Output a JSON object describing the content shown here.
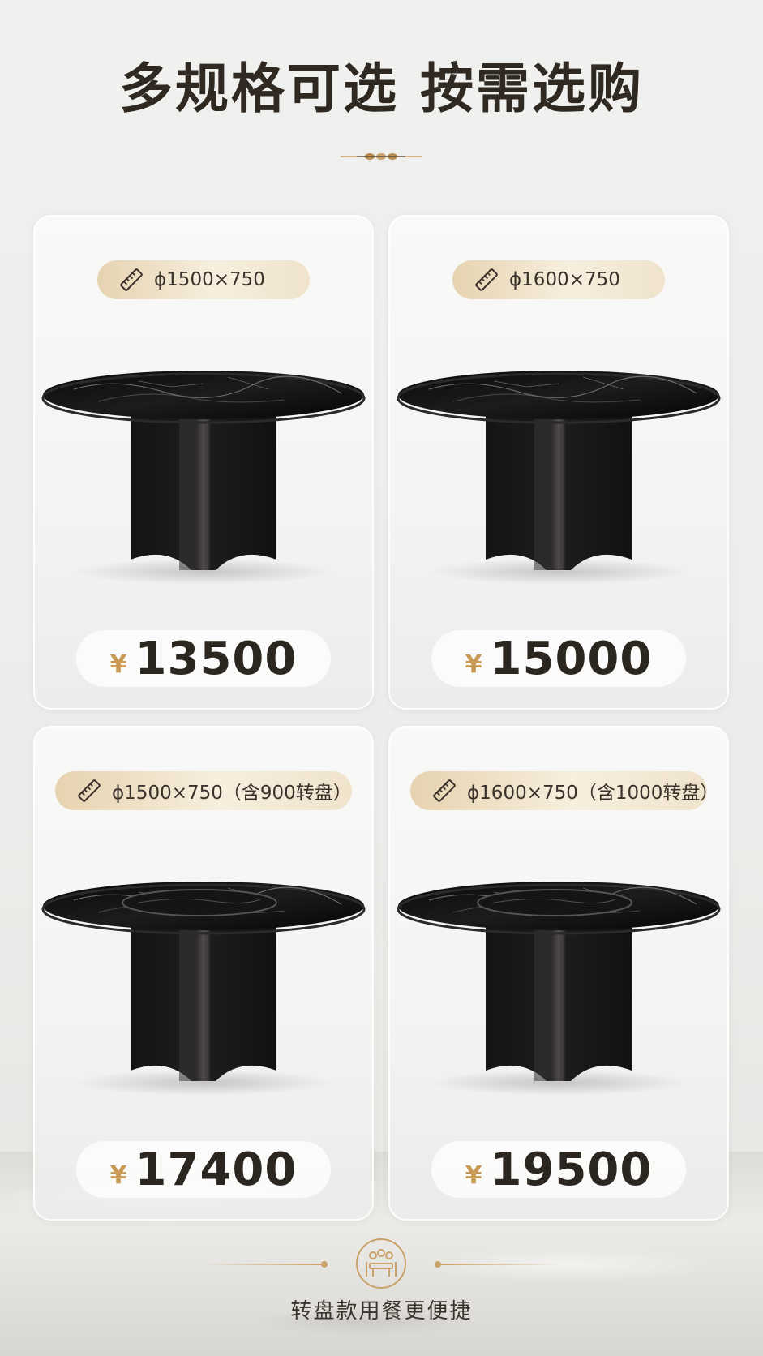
{
  "header": {
    "title": "多规格可选 按需选购"
  },
  "colors": {
    "accent_gold": "#c9a26a",
    "text_dark": "#2f2922",
    "pill_gold": "#efe3cc"
  },
  "products": [
    {
      "spec": "ϕ1500×750",
      "currency": "¥",
      "price": "13500",
      "turntable": false
    },
    {
      "spec": "ϕ1600×750",
      "currency": "¥",
      "price": "15000",
      "turntable": false
    },
    {
      "spec": "ϕ1500×750（含900转盘）",
      "currency": "¥",
      "price": "17400",
      "turntable": true
    },
    {
      "spec": "ϕ1600×750（含1000转盘）",
      "currency": "¥",
      "price": "19500",
      "turntable": true
    }
  ],
  "icons": {
    "spec": "ruler-icon",
    "footer": "dining-people-icon"
  },
  "footer": {
    "text": "转盘款用餐更便捷"
  }
}
